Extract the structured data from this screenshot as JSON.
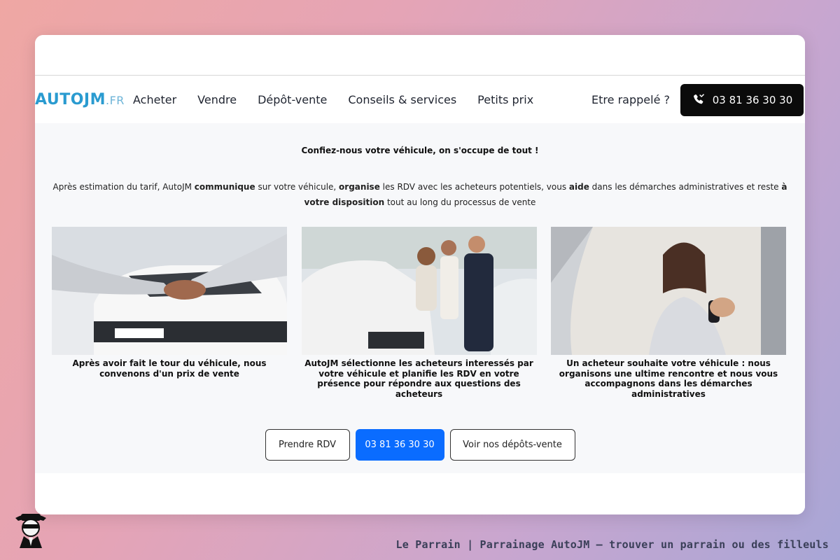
{
  "nav": {
    "logo_main": "AUTOJM",
    "logo_suffix": ".FR",
    "items": [
      "Acheter",
      "Vendre",
      "Dépôt-vente",
      "Conseils & services",
      "Petits prix"
    ],
    "callback_label": "Etre rappelé ?",
    "phone_label": "03 81 36 30 30"
  },
  "main": {
    "headline": "Confiez-nous votre véhicule, on s'occupe de tout !",
    "intro": {
      "p1": "Après estimation du tarif, AutoJM ",
      "b1": "communique",
      "p2": " sur votre véhicule, ",
      "b2": "organise",
      "p3": " les RDV avec les acheteurs potentiels, vous ",
      "b3": "aide",
      "p4": " dans les démarches administratives et reste ",
      "b4": "à votre disposition",
      "p5": " tout au long du processus de vente"
    },
    "steps": [
      {
        "caption": "Après avoir fait le tour du véhicule, nous convenons d'un prix de vente",
        "image": "handshake-car"
      },
      {
        "caption": "AutoJM sélectionne les acheteurs interessés par votre véhicule et planifie les RDV en votre présence pour répondre aux questions des acheteurs",
        "image": "dealer-couple"
      },
      {
        "caption": "Un acheteur souhaite votre véhicule : nous organisons une ultime rencontre et nous vous accompagnons dans les démarches administratives",
        "image": "woman-keys"
      }
    ],
    "buttons": {
      "rdv": "Prendre RDV",
      "phone": "03 81 36 30 30",
      "depots": "Voir nos dépôts-vente"
    }
  },
  "footer": {
    "credit": "Le Parrain | Parrainage AutoJM — trouver un parrain ou des filleuls"
  },
  "colors": {
    "accent_blue": "#0a6cff",
    "logo_blue": "#2a9bd0",
    "phone_black": "#0b0b0b"
  }
}
